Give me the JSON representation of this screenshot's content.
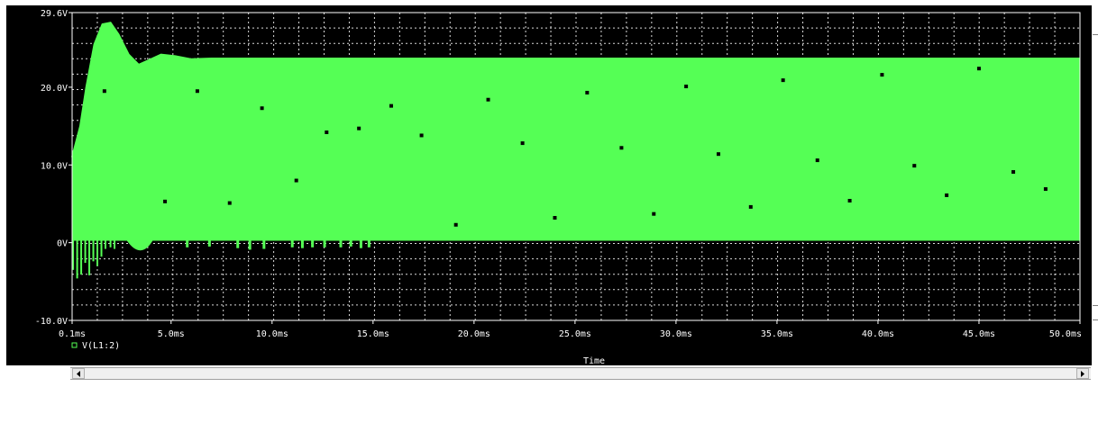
{
  "chart_data": {
    "type": "line",
    "title": "",
    "xlabel": "Time",
    "ylabel": "",
    "xlim": [
      0.1,
      50.0
    ],
    "ylim": [
      -10.0,
      29.6
    ],
    "x_ticks": [
      {
        "value": 0.1,
        "label": "0.1ms"
      },
      {
        "value": 5.0,
        "label": "5.0ms"
      },
      {
        "value": 10.0,
        "label": "10.0ms"
      },
      {
        "value": 15.0,
        "label": "15.0ms"
      },
      {
        "value": 20.0,
        "label": "20.0ms"
      },
      {
        "value": 25.0,
        "label": "25.0ms"
      },
      {
        "value": 30.0,
        "label": "30.0ms"
      },
      {
        "value": 35.0,
        "label": "35.0ms"
      },
      {
        "value": 40.0,
        "label": "40.0ms"
      },
      {
        "value": 45.0,
        "label": "45.0ms"
      },
      {
        "value": 50.0,
        "label": "50.0ms"
      }
    ],
    "y_ticks": [
      {
        "value": 29.6,
        "label": "29.6V"
      },
      {
        "value": 20.0,
        "label": "20.0V"
      },
      {
        "value": 10.0,
        "label": "10.0V"
      },
      {
        "value": 0,
        "label": "0V"
      },
      {
        "value": -10.0,
        "label": "-10.0V"
      }
    ],
    "grid": true,
    "legend_position": "bottom-left",
    "series": [
      {
        "name": "V(L1:2)",
        "color": "#55ff55",
        "band": {
          "x_start": 0.1,
          "x_end": 50.0,
          "low": 0.3,
          "high": 23.7
        },
        "upper_envelope": [
          {
            "x": 0.1,
            "y": 11.0
          },
          {
            "x": 0.5,
            "y": 15.0
          },
          {
            "x": 0.8,
            "y": 20.0
          },
          {
            "x": 1.2,
            "y": 25.5
          },
          {
            "x": 1.6,
            "y": 28.1
          },
          {
            "x": 2.0,
            "y": 28.3
          },
          {
            "x": 2.4,
            "y": 26.8
          },
          {
            "x": 2.9,
            "y": 24.2
          },
          {
            "x": 3.4,
            "y": 22.9
          },
          {
            "x": 4.0,
            "y": 23.6
          },
          {
            "x": 4.5,
            "y": 24.2
          },
          {
            "x": 5.2,
            "y": 24.0
          },
          {
            "x": 6.0,
            "y": 23.6
          },
          {
            "x": 7.0,
            "y": 23.7
          },
          {
            "x": 50.0,
            "y": 23.7
          }
        ],
        "markers": [
          {
            "x": 1.7,
            "y": 19.5
          },
          {
            "x": 4.7,
            "y": 5.3
          },
          {
            "x": 6.3,
            "y": 19.5
          },
          {
            "x": 7.9,
            "y": 5.1
          },
          {
            "x": 9.5,
            "y": 17.3
          },
          {
            "x": 11.2,
            "y": 8.0
          },
          {
            "x": 12.7,
            "y": 14.2
          },
          {
            "x": 14.3,
            "y": 14.7
          },
          {
            "x": 15.9,
            "y": 17.6
          },
          {
            "x": 17.4,
            "y": 13.8
          },
          {
            "x": 19.1,
            "y": 2.3
          },
          {
            "x": 20.7,
            "y": 18.4
          },
          {
            "x": 22.4,
            "y": 12.8
          },
          {
            "x": 24.0,
            "y": 3.2
          },
          {
            "x": 25.6,
            "y": 19.3
          },
          {
            "x": 27.3,
            "y": 12.2
          },
          {
            "x": 28.9,
            "y": 3.7
          },
          {
            "x": 30.5,
            "y": 20.1
          },
          {
            "x": 32.1,
            "y": 11.4
          },
          {
            "x": 33.7,
            "y": 4.6
          },
          {
            "x": 35.3,
            "y": 20.9
          },
          {
            "x": 37.0,
            "y": 10.6
          },
          {
            "x": 38.6,
            "y": 5.4
          },
          {
            "x": 40.2,
            "y": 21.6
          },
          {
            "x": 41.8,
            "y": 9.9
          },
          {
            "x": 43.4,
            "y": 6.1
          },
          {
            "x": 45.0,
            "y": 22.4
          },
          {
            "x": 46.7,
            "y": 9.1
          },
          {
            "x": 48.3,
            "y": 6.9
          }
        ]
      }
    ]
  },
  "colors": {
    "background": "#000000",
    "trace": "#55ff55",
    "grid": "#ffffff",
    "text": "#ffffff"
  },
  "icons": {
    "scroll_left": "left-arrow-icon",
    "scroll_right": "right-arrow-icon"
  }
}
